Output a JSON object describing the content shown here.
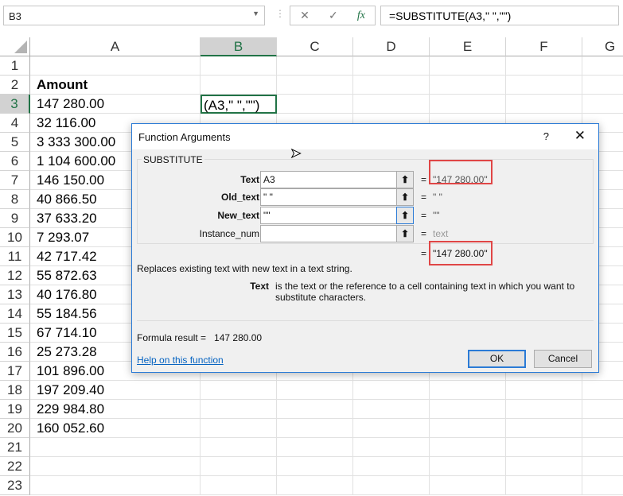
{
  "formula_bar": {
    "name_box": "B3",
    "cancel_icon": "✕",
    "enter_icon": "✓",
    "fx_icon": "fx",
    "formula": "=SUBSTITUTE(A3,\" \",\"\")"
  },
  "columns": [
    "A",
    "B",
    "C",
    "D",
    "E",
    "F",
    "G"
  ],
  "rows": [
    "1",
    "2",
    "3",
    "4",
    "5",
    "6",
    "7",
    "8",
    "9",
    "10",
    "11",
    "12",
    "13",
    "14",
    "15",
    "16",
    "17",
    "18",
    "19",
    "20",
    "21",
    "22",
    "23"
  ],
  "header_cell": "Amount",
  "amounts": [
    "147 280.00",
    "32 116.00",
    "3 333 300.00",
    "1 104 600.00",
    "146 150.00",
    "40 866.50",
    "37 633.20",
    "7 293.07",
    "42 717.42",
    "55 872.63",
    "40 176.80",
    "55 184.56",
    "67 714.10",
    "25 273.28",
    "101 896.00",
    "197 209.40",
    "229 984.80",
    "160 052.60"
  ],
  "b3_edit": "(A3,\" \",\"\")",
  "dialog": {
    "title": "Function Arguments",
    "help_q": "?",
    "close": "✕",
    "function_name": "SUBSTITUTE",
    "args": [
      {
        "label": "Text",
        "value": "A3",
        "result": "\"147 280.00\""
      },
      {
        "label": "Old_text",
        "value": "\" \"",
        "result": "\" \""
      },
      {
        "label": "New_text",
        "value": "\"\"",
        "result": "\"\""
      },
      {
        "label": "Instance_num",
        "value": "",
        "result": "text"
      }
    ],
    "equals": "=",
    "overall_result": "\"147 280.00\"",
    "description": "Replaces existing text with new text in a text string.",
    "arg_desc_label": "Text",
    "arg_desc": "is the text or the reference to a cell containing text in which you want to substitute characters.",
    "formula_result_label": "Formula result =",
    "formula_result": "147 280.00",
    "help_link": "Help on this function",
    "ok": "OK",
    "cancel": "Cancel"
  }
}
